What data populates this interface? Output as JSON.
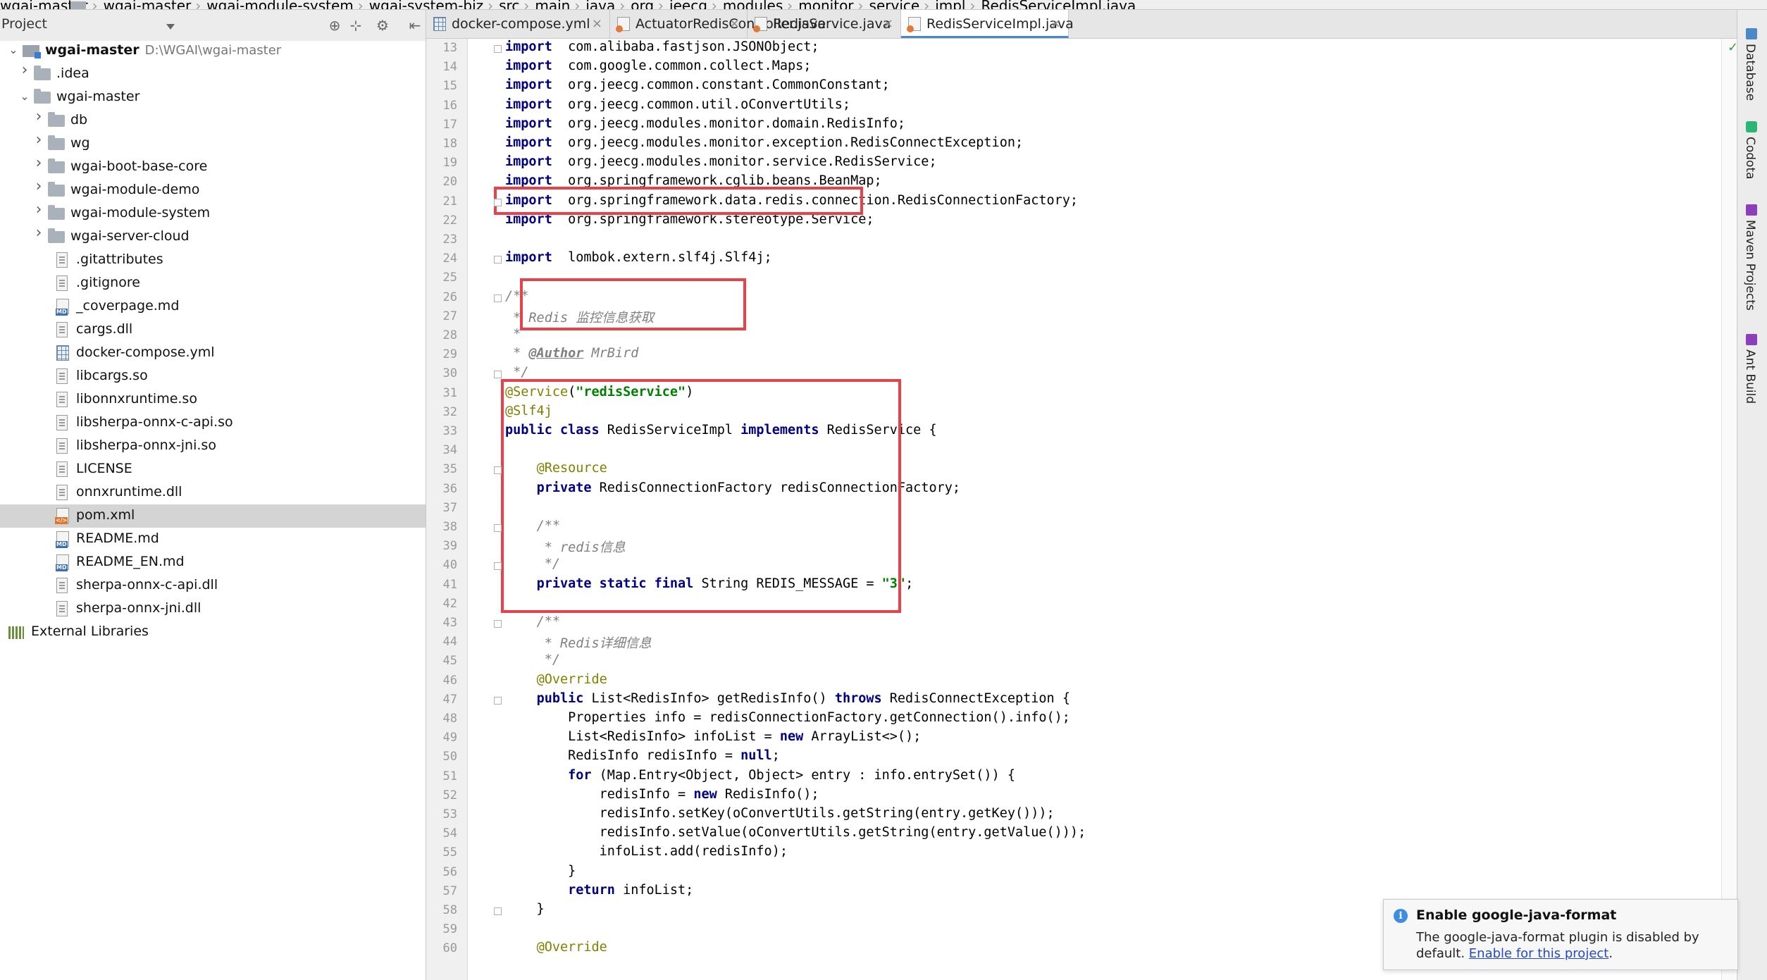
{
  "navbar": {
    "crumbs": [
      "wgai-master",
      "wgai-master",
      "wgai-module-system",
      "wgai-system-biz",
      "src",
      "main",
      "java",
      "org",
      "jeecg",
      "modules",
      "monitor",
      "service",
      "impl",
      "RedisServiceImpl.java"
    ]
  },
  "project_panel": {
    "title": "Project",
    "tree": [
      {
        "label": "wgai-master",
        "path": "D:\\WGAI\\wgai-master",
        "icon": "module-icon",
        "depth": 0,
        "arrow": "down",
        "bold": true
      },
      {
        "label": ".idea",
        "icon": "folder-icon",
        "depth": 1,
        "arrow": "right"
      },
      {
        "label": "wgai-master",
        "icon": "folder-icon",
        "depth": 1,
        "arrow": "down"
      },
      {
        "label": "db",
        "icon": "folder-icon",
        "depth": 2,
        "arrow": "right"
      },
      {
        "label": "wg",
        "icon": "folder-icon",
        "depth": 2,
        "arrow": "right"
      },
      {
        "label": "wgai-boot-base-core",
        "icon": "folder-icon",
        "depth": 2,
        "arrow": "right"
      },
      {
        "label": "wgai-module-demo",
        "icon": "folder-icon",
        "depth": 2,
        "arrow": "right"
      },
      {
        "label": "wgai-module-system",
        "icon": "folder-icon",
        "depth": 2,
        "arrow": "right"
      },
      {
        "label": "wgai-server-cloud",
        "icon": "folder-icon",
        "depth": 2,
        "arrow": "right"
      },
      {
        "label": ".gitattributes",
        "icon": "file-icon",
        "depth": 2
      },
      {
        "label": ".gitignore",
        "icon": "file-icon",
        "depth": 2
      },
      {
        "label": "_coverpage.md",
        "icon": "markdown-file-icon",
        "depth": 2
      },
      {
        "label": "cargs.dll",
        "icon": "file-icon",
        "depth": 2
      },
      {
        "label": "docker-compose.yml",
        "icon": "yaml-file-icon",
        "depth": 2
      },
      {
        "label": "libcargs.so",
        "icon": "file-icon",
        "depth": 2
      },
      {
        "label": "libonnxruntime.so",
        "icon": "file-icon",
        "depth": 2
      },
      {
        "label": "libsherpa-onnx-c-api.so",
        "icon": "file-icon",
        "depth": 2
      },
      {
        "label": "libsherpa-onnx-jni.so",
        "icon": "file-icon",
        "depth": 2
      },
      {
        "label": "LICENSE",
        "icon": "file-icon",
        "depth": 2
      },
      {
        "label": "onnxruntime.dll",
        "icon": "file-icon",
        "depth": 2
      },
      {
        "label": "pom.xml",
        "icon": "xml-file-icon",
        "depth": 2,
        "selected": true
      },
      {
        "label": "README.md",
        "icon": "markdown-file-icon",
        "depth": 2
      },
      {
        "label": "README_EN.md",
        "icon": "markdown-file-icon",
        "depth": 2
      },
      {
        "label": "sherpa-onnx-c-api.dll",
        "icon": "file-icon",
        "depth": 2
      },
      {
        "label": "sherpa-onnx-jni.dll",
        "icon": "file-icon",
        "depth": 2
      },
      {
        "label": "External Libraries",
        "icon": "libraries-icon",
        "depth": 0
      }
    ]
  },
  "tabs": [
    {
      "label": "docker-compose.yml",
      "icon": "yml",
      "active": false
    },
    {
      "label": "ActuatorRedisController.java",
      "icon": "java",
      "active": false
    },
    {
      "label": "RedisService.java",
      "icon": "java",
      "active": false
    },
    {
      "label": "RedisServiceImpl.java",
      "icon": "java",
      "active": true
    }
  ],
  "tab_close_glyph": "×",
  "editor": {
    "lines": [
      {
        "n": "13",
        "segs": [
          [
            "kw",
            "import"
          ],
          [
            "",
            "  com.alibaba.fastjson.JSONObject;"
          ]
        ]
      },
      {
        "n": "14",
        "segs": [
          [
            "kw",
            "import"
          ],
          [
            "",
            "  com.google.common.collect.Maps;"
          ]
        ]
      },
      {
        "n": "15",
        "segs": [
          [
            "kw",
            "import"
          ],
          [
            "",
            "  org.jeecg.common.constant.CommonConstant;"
          ]
        ]
      },
      {
        "n": "16",
        "segs": [
          [
            "kw",
            "import"
          ],
          [
            "",
            "  org.jeecg.common.util.oConvertUtils;"
          ]
        ]
      },
      {
        "n": "17",
        "segs": [
          [
            "kw",
            "import"
          ],
          [
            "",
            "  org.jeecg.modules.monitor.domain.RedisInfo;"
          ]
        ]
      },
      {
        "n": "18",
        "segs": [
          [
            "kw",
            "import"
          ],
          [
            "",
            "  org.jeecg.modules.monitor.exception.RedisConnectException;"
          ]
        ]
      },
      {
        "n": "19",
        "segs": [
          [
            "kw",
            "import"
          ],
          [
            "",
            "  org.jeecg.modules.monitor.service.RedisService;"
          ]
        ]
      },
      {
        "n": "20",
        "segs": [
          [
            "kw",
            "import"
          ],
          [
            "",
            "  org.springframework.cglib.beans.BeanMap;"
          ]
        ]
      },
      {
        "n": "21",
        "segs": [
          [
            "kw",
            "import"
          ],
          [
            "",
            "  org.springframework.data.redis.connection.RedisConnectionFactory;"
          ]
        ]
      },
      {
        "n": "22",
        "segs": [
          [
            "kw",
            "import"
          ],
          [
            "",
            "  org.springframework.stereotype.Service;"
          ]
        ]
      },
      {
        "n": "23",
        "segs": []
      },
      {
        "n": "24",
        "segs": [
          [
            "kw",
            "import"
          ],
          [
            "",
            "  lombok.extern.slf4j.Slf4j;"
          ]
        ]
      },
      {
        "n": "25",
        "segs": []
      },
      {
        "n": "26",
        "segs": [
          [
            "cm",
            "/**"
          ]
        ]
      },
      {
        "n": "27",
        "segs": [
          [
            "cm",
            " * Redis 监控信息获取"
          ]
        ]
      },
      {
        "n": "28",
        "segs": [
          [
            "cm",
            " *"
          ]
        ]
      },
      {
        "n": "29",
        "segs": [
          [
            "cm",
            " * "
          ],
          [
            "tag",
            "@Author"
          ],
          [
            "cm",
            " MrBird"
          ]
        ]
      },
      {
        "n": "30",
        "segs": [
          [
            "cm",
            " */"
          ]
        ]
      },
      {
        "n": "31",
        "segs": [
          [
            "an",
            "@Service"
          ],
          [
            "",
            "("
          ],
          [
            "str",
            "\"redisService\""
          ],
          [
            "",
            ")"
          ]
        ]
      },
      {
        "n": "32",
        "segs": [
          [
            "an",
            "@Slf4j"
          ]
        ]
      },
      {
        "n": "33",
        "segs": [
          [
            "kw",
            "public class"
          ],
          [
            "",
            " RedisServiceImpl "
          ],
          [
            "kw",
            "implements"
          ],
          [
            "",
            " RedisService {"
          ]
        ]
      },
      {
        "n": "34",
        "segs": []
      },
      {
        "n": "35",
        "segs": [
          [
            "",
            "    "
          ],
          [
            "an",
            "@Resource"
          ]
        ]
      },
      {
        "n": "36",
        "segs": [
          [
            "",
            "    "
          ],
          [
            "kw",
            "private"
          ],
          [
            "",
            " RedisConnectionFactory redisConnectionFactory;"
          ]
        ]
      },
      {
        "n": "37",
        "segs": []
      },
      {
        "n": "38",
        "segs": [
          [
            "",
            "    "
          ],
          [
            "cm",
            "/**"
          ]
        ]
      },
      {
        "n": "39",
        "segs": [
          [
            "",
            "    "
          ],
          [
            "cm",
            " * redis信息"
          ]
        ]
      },
      {
        "n": "40",
        "segs": [
          [
            "",
            "    "
          ],
          [
            "cm",
            " */"
          ]
        ]
      },
      {
        "n": "41",
        "segs": [
          [
            "",
            "    "
          ],
          [
            "kw",
            "private static final"
          ],
          [
            "",
            " String REDIS_MESSAGE = "
          ],
          [
            "str",
            "\"3\""
          ],
          [
            "",
            ";"
          ]
        ]
      },
      {
        "n": "42",
        "segs": []
      },
      {
        "n": "43",
        "segs": [
          [
            "",
            "    "
          ],
          [
            "cm",
            "/**"
          ]
        ]
      },
      {
        "n": "44",
        "segs": [
          [
            "",
            "    "
          ],
          [
            "cm",
            " * Redis详细信息"
          ]
        ]
      },
      {
        "n": "45",
        "segs": [
          [
            "",
            "    "
          ],
          [
            "cm",
            " */"
          ]
        ]
      },
      {
        "n": "46",
        "segs": [
          [
            "",
            "    "
          ],
          [
            "an",
            "@Override"
          ]
        ]
      },
      {
        "n": "47",
        "segs": [
          [
            "",
            "    "
          ],
          [
            "kw",
            "public"
          ],
          [
            "",
            " List<RedisInfo> getRedisInfo() "
          ],
          [
            "kw",
            "throws"
          ],
          [
            "",
            " RedisConnectException {"
          ]
        ]
      },
      {
        "n": "48",
        "segs": [
          [
            "",
            "        Properties info = redisConnectionFactory.getConnection().info();"
          ]
        ]
      },
      {
        "n": "49",
        "segs": [
          [
            "",
            "        List<RedisInfo> infoList = "
          ],
          [
            "kw",
            "new"
          ],
          [
            "",
            " ArrayList<>();"
          ]
        ]
      },
      {
        "n": "50",
        "segs": [
          [
            "",
            "        RedisInfo redisInfo = "
          ],
          [
            "kw",
            "null"
          ],
          [
            "",
            ";"
          ]
        ]
      },
      {
        "n": "51",
        "segs": [
          [
            "",
            "        "
          ],
          [
            "kw",
            "for"
          ],
          [
            "",
            " (Map.Entry<Object, Object> entry : info.entrySet()) {"
          ]
        ]
      },
      {
        "n": "52",
        "segs": [
          [
            "",
            "            redisInfo = "
          ],
          [
            "kw",
            "new"
          ],
          [
            "",
            " RedisInfo();"
          ]
        ]
      },
      {
        "n": "53",
        "segs": [
          [
            "",
            "            redisInfo.setKey(oConvertUtils.getString(entry.getKey()));"
          ]
        ]
      },
      {
        "n": "54",
        "segs": [
          [
            "",
            "            redisInfo.setValue(oConvertUtils.getString(entry.getValue()));"
          ]
        ]
      },
      {
        "n": "55",
        "segs": [
          [
            "",
            "            infoList.add(redisInfo);"
          ]
        ]
      },
      {
        "n": "56",
        "segs": [
          [
            "",
            "        }"
          ]
        ]
      },
      {
        "n": "57",
        "segs": [
          [
            "",
            "        "
          ],
          [
            "kw",
            "return"
          ],
          [
            "",
            " infoList;"
          ]
        ]
      },
      {
        "n": "58",
        "segs": [
          [
            "",
            "    }"
          ]
        ]
      },
      {
        "n": "59",
        "segs": []
      },
      {
        "n": "60",
        "segs": [
          [
            "",
            "    "
          ],
          [
            "an",
            "@Override"
          ]
        ]
      }
    ]
  },
  "right_tools": [
    {
      "label": "Database",
      "icon": "database-icon"
    },
    {
      "label": "Codota",
      "icon": "codota-icon"
    },
    {
      "label": "Maven Projects",
      "icon": "maven-icon"
    },
    {
      "label": "Ant Build",
      "icon": "ant-icon"
    }
  ],
  "notification": {
    "title": "Enable google-java-format",
    "body": "The google-java-format plugin is disabled by default.",
    "link": "Enable for this project",
    "tail": "."
  },
  "colors": {
    "highlight_box": "#e8414a",
    "keyword": "#000080",
    "string": "#008000",
    "annotation": "#808000",
    "comment": "#808080",
    "selection": "#d4d4d4",
    "link": "#2449c9"
  }
}
